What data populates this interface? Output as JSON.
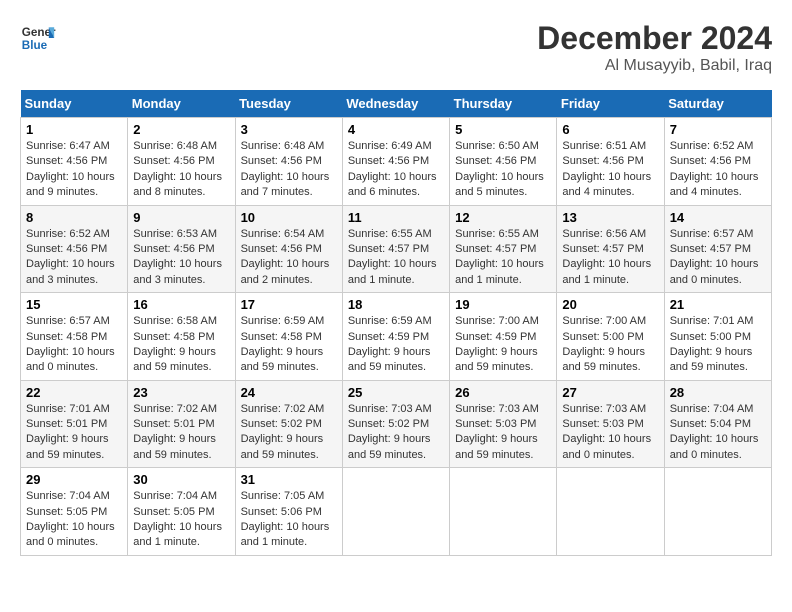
{
  "header": {
    "logo_line1": "General",
    "logo_line2": "Blue",
    "month": "December 2024",
    "location": "Al Musayyib, Babil, Iraq"
  },
  "weekdays": [
    "Sunday",
    "Monday",
    "Tuesday",
    "Wednesday",
    "Thursday",
    "Friday",
    "Saturday"
  ],
  "weeks": [
    [
      {
        "day": "1",
        "sunrise": "6:47 AM",
        "sunset": "4:56 PM",
        "daylight": "10 hours and 9 minutes."
      },
      {
        "day": "2",
        "sunrise": "6:48 AM",
        "sunset": "4:56 PM",
        "daylight": "10 hours and 8 minutes."
      },
      {
        "day": "3",
        "sunrise": "6:48 AM",
        "sunset": "4:56 PM",
        "daylight": "10 hours and 7 minutes."
      },
      {
        "day": "4",
        "sunrise": "6:49 AM",
        "sunset": "4:56 PM",
        "daylight": "10 hours and 6 minutes."
      },
      {
        "day": "5",
        "sunrise": "6:50 AM",
        "sunset": "4:56 PM",
        "daylight": "10 hours and 5 minutes."
      },
      {
        "day": "6",
        "sunrise": "6:51 AM",
        "sunset": "4:56 PM",
        "daylight": "10 hours and 4 minutes."
      },
      {
        "day": "7",
        "sunrise": "6:52 AM",
        "sunset": "4:56 PM",
        "daylight": "10 hours and 4 minutes."
      }
    ],
    [
      {
        "day": "8",
        "sunrise": "6:52 AM",
        "sunset": "4:56 PM",
        "daylight": "10 hours and 3 minutes."
      },
      {
        "day": "9",
        "sunrise": "6:53 AM",
        "sunset": "4:56 PM",
        "daylight": "10 hours and 3 minutes."
      },
      {
        "day": "10",
        "sunrise": "6:54 AM",
        "sunset": "4:56 PM",
        "daylight": "10 hours and 2 minutes."
      },
      {
        "day": "11",
        "sunrise": "6:55 AM",
        "sunset": "4:57 PM",
        "daylight": "10 hours and 1 minute."
      },
      {
        "day": "12",
        "sunrise": "6:55 AM",
        "sunset": "4:57 PM",
        "daylight": "10 hours and 1 minute."
      },
      {
        "day": "13",
        "sunrise": "6:56 AM",
        "sunset": "4:57 PM",
        "daylight": "10 hours and 1 minute."
      },
      {
        "day": "14",
        "sunrise": "6:57 AM",
        "sunset": "4:57 PM",
        "daylight": "10 hours and 0 minutes."
      }
    ],
    [
      {
        "day": "15",
        "sunrise": "6:57 AM",
        "sunset": "4:58 PM",
        "daylight": "10 hours and 0 minutes."
      },
      {
        "day": "16",
        "sunrise": "6:58 AM",
        "sunset": "4:58 PM",
        "daylight": "9 hours and 59 minutes."
      },
      {
        "day": "17",
        "sunrise": "6:59 AM",
        "sunset": "4:58 PM",
        "daylight": "9 hours and 59 minutes."
      },
      {
        "day": "18",
        "sunrise": "6:59 AM",
        "sunset": "4:59 PM",
        "daylight": "9 hours and 59 minutes."
      },
      {
        "day": "19",
        "sunrise": "7:00 AM",
        "sunset": "4:59 PM",
        "daylight": "9 hours and 59 minutes."
      },
      {
        "day": "20",
        "sunrise": "7:00 AM",
        "sunset": "5:00 PM",
        "daylight": "9 hours and 59 minutes."
      },
      {
        "day": "21",
        "sunrise": "7:01 AM",
        "sunset": "5:00 PM",
        "daylight": "9 hours and 59 minutes."
      }
    ],
    [
      {
        "day": "22",
        "sunrise": "7:01 AM",
        "sunset": "5:01 PM",
        "daylight": "9 hours and 59 minutes."
      },
      {
        "day": "23",
        "sunrise": "7:02 AM",
        "sunset": "5:01 PM",
        "daylight": "9 hours and 59 minutes."
      },
      {
        "day": "24",
        "sunrise": "7:02 AM",
        "sunset": "5:02 PM",
        "daylight": "9 hours and 59 minutes."
      },
      {
        "day": "25",
        "sunrise": "7:03 AM",
        "sunset": "5:02 PM",
        "daylight": "9 hours and 59 minutes."
      },
      {
        "day": "26",
        "sunrise": "7:03 AM",
        "sunset": "5:03 PM",
        "daylight": "9 hours and 59 minutes."
      },
      {
        "day": "27",
        "sunrise": "7:03 AM",
        "sunset": "5:03 PM",
        "daylight": "10 hours and 0 minutes."
      },
      {
        "day": "28",
        "sunrise": "7:04 AM",
        "sunset": "5:04 PM",
        "daylight": "10 hours and 0 minutes."
      }
    ],
    [
      {
        "day": "29",
        "sunrise": "7:04 AM",
        "sunset": "5:05 PM",
        "daylight": "10 hours and 0 minutes."
      },
      {
        "day": "30",
        "sunrise": "7:04 AM",
        "sunset": "5:05 PM",
        "daylight": "10 hours and 1 minute."
      },
      {
        "day": "31",
        "sunrise": "7:05 AM",
        "sunset": "5:06 PM",
        "daylight": "10 hours and 1 minute."
      },
      null,
      null,
      null,
      null
    ]
  ],
  "labels": {
    "sunrise": "Sunrise:",
    "sunset": "Sunset:",
    "daylight": "Daylight:"
  }
}
